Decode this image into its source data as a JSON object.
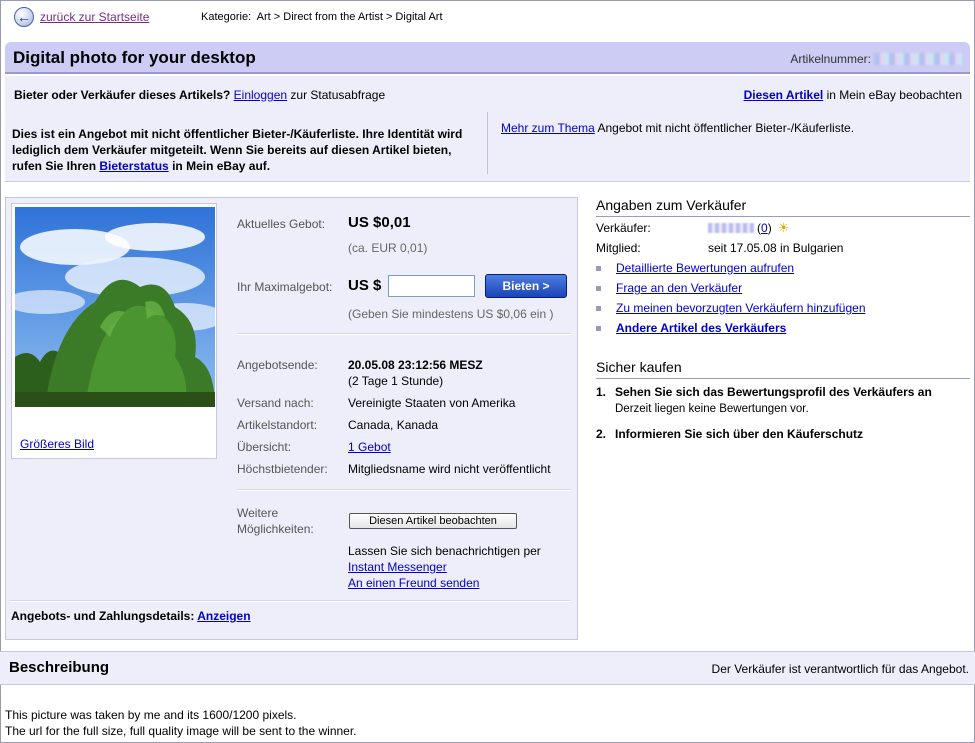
{
  "nav": {
    "back_label": "zurück zur Startseite",
    "category_prefix": "Kategorie:",
    "category_path": "Art > Direct from the Artist > Digital Art"
  },
  "title": {
    "heading": "Digital photo for your desktop",
    "item_number_label": "Artikelnummer:"
  },
  "info": {
    "prompt": "Bieter oder Verkäufer dieses Artikels?",
    "login_link": "Einloggen",
    "login_suffix": "zur Statusabfrage",
    "watch_link": "Diesen Artikel",
    "watch_suffix": "in Mein eBay beobachten",
    "notice_text": "Dies ist ein Angebot mit nicht öffentlicher Bieter-/Käuferliste. Ihre Identität wird lediglich dem Verkäufer mitgeteilt. Wenn Sie bereits auf diesen Artikel bieten, rufen Sie Ihren",
    "notice_link": "Bieterstatus",
    "notice_suffix": "in Mein eBay auf.",
    "more_link": "Mehr zum Thema",
    "more_text": "Angebot mit nicht öffentlicher Bieter-/Käuferliste."
  },
  "bid": {
    "bigger_image": "Größeres Bild",
    "current_bid_label": "Aktuelles Gebot:",
    "current_bid_value": "US $0,01",
    "current_bid_eur": "(ca. EUR 0,01)",
    "max_bid_label": "Ihr Maximalgebot:",
    "currency": "US $",
    "bid_input_value": "",
    "bid_button": "Bieten >",
    "min_bid_hint": "(Geben Sie mindestens US $0,06 ein )",
    "end_label": "Angebotsende:",
    "end_value": "20.05.08 23:12:56 MESZ",
    "end_remaining": "(2 Tage 1 Stunde)",
    "shipping_label": "Versand nach:",
    "shipping_value": "Vereinigte Staaten von Amerika",
    "location_label": "Artikelstandort:",
    "location_value": "Canada, Kanada",
    "overview_label": "Übersicht:",
    "overview_link": "1 Gebot",
    "high_bidder_label": "Höchstbietender:",
    "high_bidder_value": "Mitgliedsname wird nicht veröffentlicht",
    "more_options_label_1": "Weitere",
    "more_options_label_2": "Möglichkeiten:",
    "watch_button": "Diesen Artikel beobachten",
    "notify_text": "Lassen Sie sich benachrichtigen per",
    "im_link": "Instant Messenger",
    "friend_link": "An einen Freund senden",
    "payment_label": "Angebots- und Zahlungsdetails:",
    "payment_link": "Anzeigen"
  },
  "seller": {
    "title": "Angaben zum Verkäufer",
    "seller_label": "Verkäufer:",
    "feedback_score": "0",
    "member_label": "Mitglied:",
    "member_value": "seit 17.05.08 in Bulgarien",
    "links": [
      "Detaillierte Bewertungen aufrufen",
      "Frage an den Verkäufer",
      "Zu meinen bevorzugten Verkäufern hinzufügen",
      "Andere Artikel des Verkäufers"
    ]
  },
  "safe": {
    "title": "Sicher kaufen",
    "step1_num": "1.",
    "step1_head": "Sehen Sie sich das Bewertungsprofil des Verkäufers an",
    "step1_sub": "Derzeit liegen keine Bewertungen vor.",
    "step2_num": "2.",
    "step2_head": "Informieren Sie sich über den Käuferschutz"
  },
  "description": {
    "title": "Beschreibung",
    "note": "Der Verkäufer ist verantwortlich für das Angebot.",
    "line1": "This picture was taken by me and its 1600/1200 pixels.",
    "line2": "The url for the full size, full quality image will be sent to the winner."
  },
  "icons": {
    "back": "back-arrow-icon",
    "new_member": "new-member-sunglasses-icon"
  }
}
